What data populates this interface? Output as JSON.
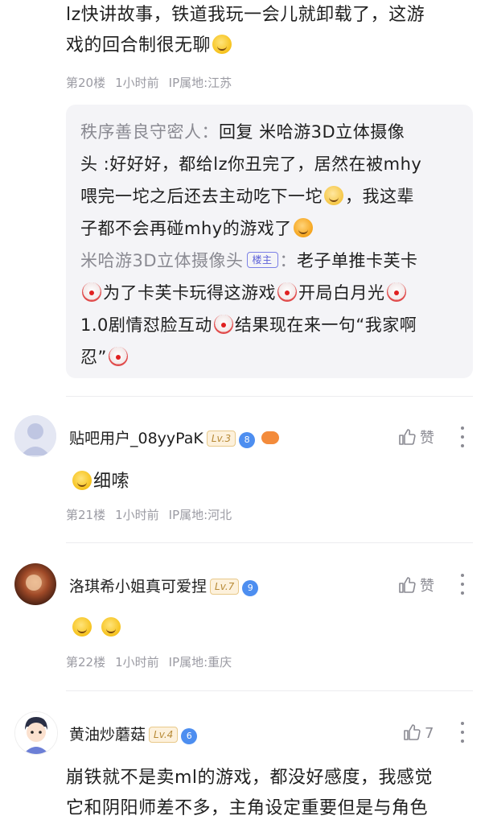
{
  "post_top": {
    "line1": "lz快讲故事，铁道我玩一会儿就卸载了，这游",
    "line2": "戏的回合制很无聊",
    "floor": "第20楼",
    "time": "1小时前",
    "ip": "IP属地:江苏"
  },
  "replies": {
    "r1_name": "秩序善良守密人：",
    "r1_text1": "回复 米哈游3D立体摄像",
    "r1_text2": "头 :好好好，都给lz你丑完了，居然在被mhy",
    "r1_text3a": "喂完一坨之后还去主动吃下一坨",
    "r1_text3b": "，我这辈",
    "r1_text4": "子都不会再碰mhy的游戏了",
    "r2_name": "米哈游3D立体摄像头",
    "r2_badge": "楼主",
    "r2_colon": "：",
    "r2_text1": "老子单推卡芙卡",
    "r2_text2a": "为了卡芙卡玩得这游戏",
    "r2_text2b": "开局白月光",
    "r2_text3a": "1.0剧情怼脸互动",
    "r2_text3b": "结果现在来一句“我家啊",
    "r2_text4": "忍”"
  },
  "comments": [
    {
      "username": "贴吧用户_08yyPaK",
      "level": "Lv.3",
      "gem": "8",
      "like_label": "赞",
      "text": "细嗦",
      "floor": "第21楼",
      "time": "1小时前",
      "ip": "IP属地:河北"
    },
    {
      "username": "洛琪希小姐真可爱捏",
      "level": "Lv.7",
      "gem": "9",
      "like_label": "赞",
      "floor": "第22楼",
      "time": "1小时前",
      "ip": "IP属地:重庆"
    },
    {
      "username": "黄油炒蘑菇",
      "level": "Lv.4",
      "gem": "6",
      "like_label": "7",
      "text1": "崩铁就不是卖ml的游戏，都没好感度，我感觉",
      "text2": "它和阴阳师差不多，主角设定重要但是与角色"
    }
  ],
  "colors": {
    "accent": "#5b5fd8",
    "meta_gray": "#9b9ba3",
    "reply_bg": "#f4f4f7"
  }
}
